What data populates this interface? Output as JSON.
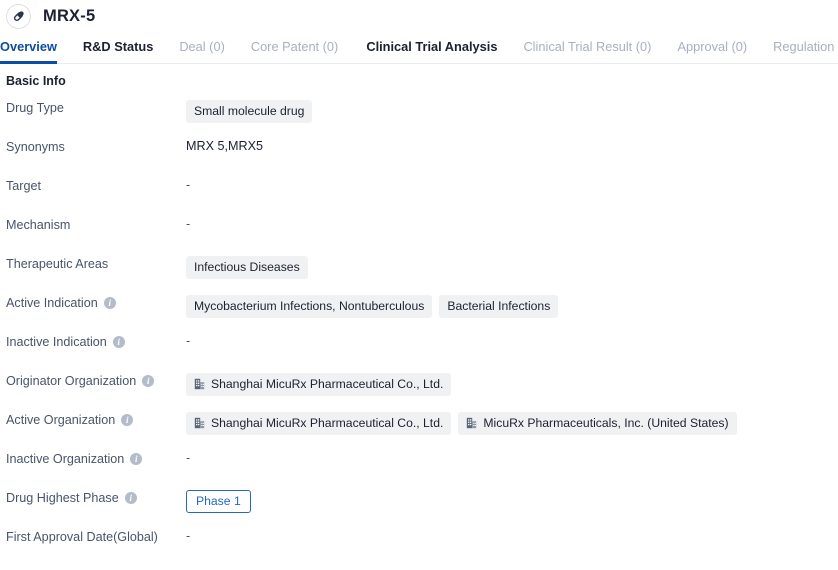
{
  "header": {
    "title": "MRX-5",
    "avatar_icon": "capsule-pill-icon"
  },
  "tabs": [
    {
      "label": "Overview",
      "state": "active"
    },
    {
      "label": "R&D Status",
      "state": "normal"
    },
    {
      "label": "Deal (0)",
      "state": "muted"
    },
    {
      "label": "Core Patent (0)",
      "state": "muted"
    },
    {
      "label": "Clinical Trial Analysis",
      "state": "normal"
    },
    {
      "label": "Clinical Trial Result (0)",
      "state": "muted"
    },
    {
      "label": "Approval (0)",
      "state": "muted"
    },
    {
      "label": "Regulation (0)",
      "state": "muted"
    }
  ],
  "section": {
    "title": "Basic Info"
  },
  "rows": [
    {
      "label": "Drug Type",
      "info": false,
      "type": "tags",
      "values": [
        "Small molecule drug"
      ]
    },
    {
      "label": "Synonyms",
      "info": false,
      "type": "text",
      "values": [
        "MRX 5,MRX5"
      ]
    },
    {
      "label": "Target",
      "info": false,
      "type": "dash",
      "values": [
        "-"
      ]
    },
    {
      "label": "Mechanism",
      "info": false,
      "type": "dash",
      "values": [
        "-"
      ]
    },
    {
      "label": "Therapeutic Areas",
      "info": false,
      "type": "tags",
      "values": [
        "Infectious Diseases"
      ]
    },
    {
      "label": "Active Indication",
      "info": true,
      "type": "tags",
      "values": [
        "Mycobacterium Infections, Nontuberculous",
        "Bacterial Infections"
      ]
    },
    {
      "label": "Inactive Indication",
      "info": true,
      "type": "dash",
      "values": [
        "-"
      ]
    },
    {
      "label": "Originator Organization",
      "info": true,
      "type": "org-tags",
      "values": [
        "Shanghai MicuRx Pharmaceutical Co., Ltd."
      ]
    },
    {
      "label": "Active Organization",
      "info": true,
      "type": "org-tags",
      "values": [
        "Shanghai MicuRx Pharmaceutical Co., Ltd.",
        "MicuRx Pharmaceuticals, Inc. (United States)"
      ]
    },
    {
      "label": "Inactive Organization",
      "info": true,
      "type": "dash",
      "values": [
        "-"
      ]
    },
    {
      "label": "Drug Highest Phase",
      "info": true,
      "type": "phase",
      "values": [
        "Phase 1"
      ]
    },
    {
      "label": "First Approval Date(Global)",
      "info": false,
      "type": "dash",
      "values": [
        "-"
      ]
    }
  ],
  "colors": {
    "accent": "#0b4da2",
    "phase_border": "#2468c4",
    "tag_bg": "#f0f1f3",
    "muted_text": "#a8b0bf"
  },
  "icons": {
    "info": "i",
    "org": "company-building-icon"
  }
}
